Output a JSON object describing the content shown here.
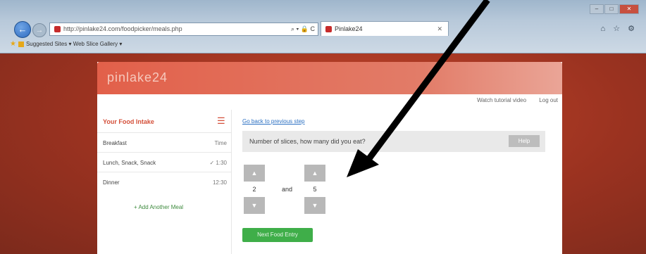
{
  "browser": {
    "url": "http://pinlake24.com/foodpicker/meals.php",
    "tab_title": "Pinlake24",
    "address_icons": "⌕ ▾ 🔒 C",
    "favorites_bar": "Suggested Sites ▾  Web Slice Gallery ▾",
    "window_controls": [
      "–",
      "□",
      "✕"
    ],
    "tools_icons": "⌂ ☆ ⚙"
  },
  "app": {
    "brand": "pinlake24",
    "top_links": [
      "Watch tutorial video",
      "Log out"
    ]
  },
  "sidebar": {
    "title": "Your Food Intake",
    "rows": [
      {
        "label": "Breakfast",
        "value": "Time"
      },
      {
        "label": "Lunch, Snack, Snack",
        "value": "✓ 1:30"
      },
      {
        "label": "Dinner",
        "value": "12:30"
      }
    ],
    "add_meal": "+ Add Another Meal"
  },
  "main": {
    "back_link": "Go back to previous step",
    "question": "Number of slices, how many did you eat?",
    "help_label": "Help",
    "first_value": "2",
    "second_value": "5",
    "and_label": "and",
    "submit_label": "Next Food Entry"
  },
  "colors": {
    "brand_header": "#e2604a",
    "accent_red": "#d4503a",
    "submit_green": "#3fae49",
    "annotation_arrow": "#000000"
  }
}
